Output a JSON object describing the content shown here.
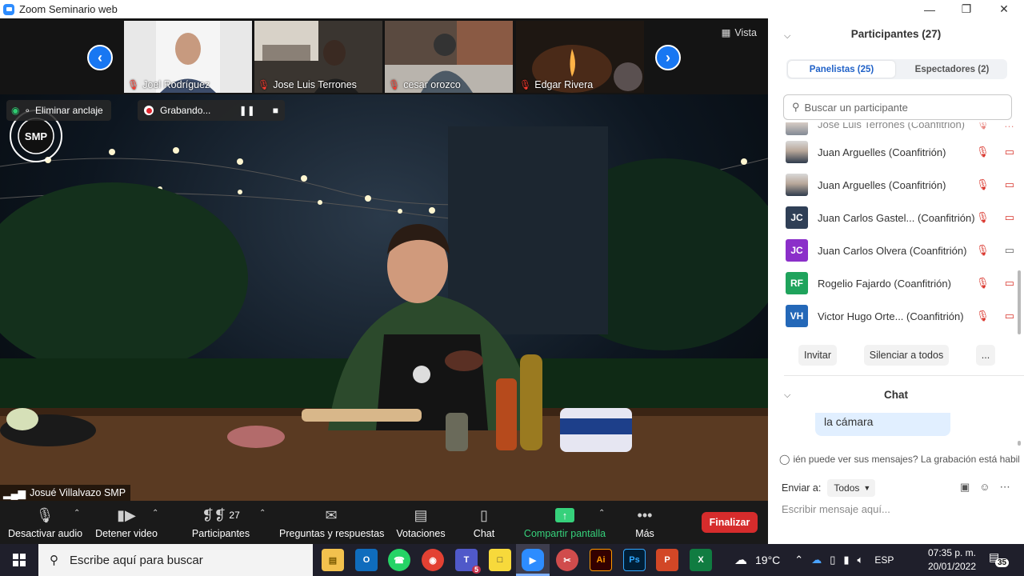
{
  "window": {
    "title": "Zoom Seminario web",
    "controls": [
      "minimize",
      "restore",
      "close"
    ]
  },
  "gallery": {
    "view_label": "Vista",
    "thumbnails": [
      {
        "name": "Joel Rodríguez",
        "muted": true
      },
      {
        "name": "Jose Luis Terrones",
        "muted": true
      },
      {
        "name": "cesar orozco",
        "muted": true
      },
      {
        "name": "Edgar Rivera",
        "muted": true
      }
    ]
  },
  "main_video": {
    "unpin_label": "Eliminar anclaje",
    "recording_label": "Grabando...",
    "speaker_name": "Josué Villalvazo SMP",
    "logo_text": "SMP"
  },
  "toolbar": {
    "mute_label": "Desactivar audio",
    "video_label": "Detener video",
    "participants_label": "Participantes",
    "participants_count": "27",
    "qa_label": "Preguntas y respuestas",
    "polls_label": "Votaciones",
    "chat_label": "Chat",
    "share_label": "Compartir pantalla",
    "more_label": "Más",
    "end_label": "Finalizar"
  },
  "panel": {
    "title": "Participantes (27)",
    "tabs": [
      {
        "label": "Panelistas (25)",
        "active": true
      },
      {
        "label": "Espectadores (2)",
        "active": false
      }
    ],
    "search_placeholder": "Buscar un participante",
    "participants": [
      {
        "name": "Jose Luis Terrones (Coanfitrión)",
        "initials": "",
        "avatar_color": "",
        "photo": true,
        "video_on": false,
        "partial": true
      },
      {
        "name": "Juan Arguelles (Coanfitrión)",
        "initials": "",
        "avatar_color": "",
        "photo": true,
        "video_on": false
      },
      {
        "name": "Juan Arguelles (Coanfitrión)",
        "initials": "",
        "avatar_color": "",
        "photo": true,
        "video_on": false
      },
      {
        "name": "Juan Carlos Gastel...  (Coanfitrión)",
        "initials": "JC",
        "avatar_color": "#2f3f56",
        "photo": false,
        "video_on": false
      },
      {
        "name": "Juan Carlos Olvera (Coanfitrión)",
        "initials": "JC",
        "avatar_color": "#8b2fc9",
        "photo": false,
        "video_on": true
      },
      {
        "name": "Rogelio Fajardo (Coanfitrión)",
        "initials": "RF",
        "avatar_color": "#1fa35c",
        "photo": false,
        "video_on": false
      },
      {
        "name": "Victor Hugo Orte...  (Coanfitrión)",
        "initials": "VH",
        "avatar_color": "#2468b8",
        "photo": false,
        "video_on": false
      }
    ],
    "actions": {
      "invite": "Invitar",
      "mute_all": "Silenciar a todos",
      "more": "..."
    }
  },
  "chat": {
    "title": "Chat",
    "bubble_text": "la cámara",
    "note": "ién puede ver sus mensajes? La grabación está habilit",
    "send_to_label": "Enviar a:",
    "send_to_value": "Todos",
    "input_placeholder": "Escribir mensaje aquí..."
  },
  "taskbar": {
    "search_placeholder": "Escribe aquí para buscar",
    "apps": [
      "file-explorer",
      "outlook",
      "whatsapp",
      "chrome",
      "teams",
      "sticky-notes",
      "zoom",
      "snipping-tool",
      "illustrator",
      "photoshop",
      "powerpoint",
      "excel"
    ],
    "teams_badge": "5",
    "weather": "19°C",
    "language": "ESP",
    "time": "07:35 p. m.",
    "date": "20/01/2022",
    "notifications": "35"
  },
  "colors": {
    "accent": "#2d8cff",
    "end_red": "#d62c2c",
    "share_green": "#36d17b",
    "muted_red": "#d9342b"
  }
}
